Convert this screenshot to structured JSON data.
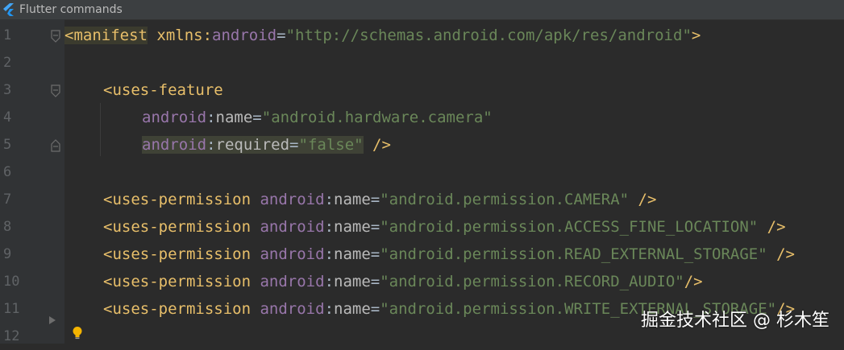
{
  "window": {
    "title": "Flutter commands"
  },
  "lines": [
    {
      "num": "1",
      "parts": [
        "<manifest",
        " xmlns:",
        "android",
        "=",
        "\"http://schemas.android.com/apk/res/android\"",
        ">"
      ]
    },
    {
      "num": "2"
    },
    {
      "num": "3",
      "parts": [
        "<uses-feature"
      ]
    },
    {
      "num": "4",
      "parts": [
        "android",
        ":",
        "name",
        "=",
        "\"android.hardware.camera\""
      ]
    },
    {
      "num": "5",
      "parts": [
        "android",
        ":",
        "required",
        "=",
        "\"false\"",
        " />"
      ]
    },
    {
      "num": "6"
    },
    {
      "num": "7",
      "parts": [
        "<uses-permission",
        " ",
        "android",
        ":",
        "name",
        "=",
        "\"android.permission.CAMERA\"",
        " />"
      ]
    },
    {
      "num": "8",
      "parts": [
        "<uses-permission",
        " ",
        "android",
        ":",
        "name",
        "=",
        "\"android.permission.ACCESS_FINE_LOCATION\"",
        " />"
      ]
    },
    {
      "num": "9",
      "parts": [
        "<uses-permission",
        " ",
        "android",
        ":",
        "name",
        "=",
        "\"android.permission.READ_EXTERNAL_STORAGE\"",
        " />"
      ]
    },
    {
      "num": "10",
      "parts": [
        "<uses-permission",
        " ",
        "android",
        ":",
        "name",
        "=",
        "\"android.permission.RECORD_AUDIO\"",
        "/>"
      ]
    },
    {
      "num": "11",
      "parts": [
        "<uses-permission",
        " ",
        "android",
        ":",
        "name",
        "=",
        "\"android.permission.WRITE_EXTERNAL_STORAGE\"",
        "/>"
      ]
    },
    {
      "num": "12"
    }
  ],
  "watermark": "掘金技术社区 @ 杉木笙",
  "colors": {
    "background": "#2b2b2b",
    "tag": "#e8bf6a",
    "namespace": "#9876aa",
    "attribute": "#bababa",
    "string": "#6a8759"
  },
  "icons": [
    "flutter-icon",
    "fold-icon",
    "lightbulb-icon",
    "collapse-arrow-icon"
  ]
}
